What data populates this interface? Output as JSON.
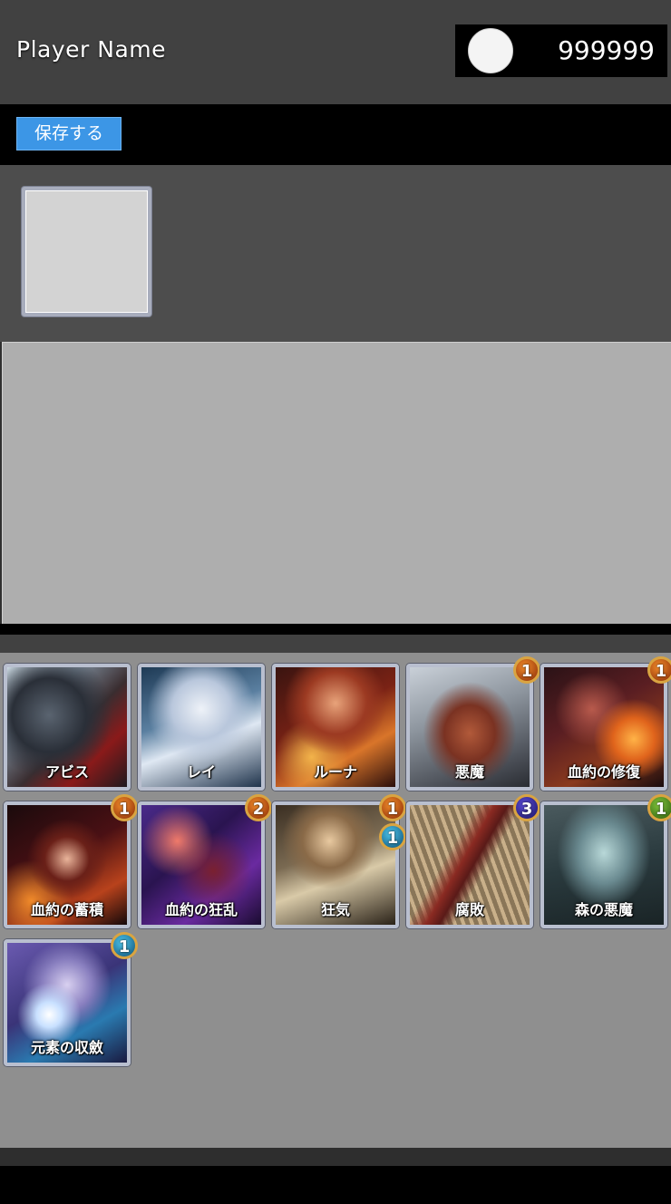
{
  "header": {
    "player_name": "Player Name",
    "currency": "999999"
  },
  "toolbar": {
    "save_label": "保存する"
  },
  "cards": [
    {
      "name": "アビス",
      "badges": []
    },
    {
      "name": "レイ",
      "badges": []
    },
    {
      "name": "ルーナ",
      "badges": []
    },
    {
      "name": "悪魔",
      "badges": [
        {
          "value": "1",
          "element": "fire"
        }
      ]
    },
    {
      "name": "血約の修復",
      "badges": [
        {
          "value": "1",
          "element": "fire"
        }
      ]
    },
    {
      "name": "血約の蓄積",
      "badges": [
        {
          "value": "1",
          "element": "fire"
        }
      ]
    },
    {
      "name": "血約の狂乱",
      "badges": [
        {
          "value": "2",
          "element": "fire"
        }
      ]
    },
    {
      "name": "狂気",
      "badges": [
        {
          "value": "1",
          "element": "fire"
        },
        {
          "value": "1",
          "element": "water"
        }
      ]
    },
    {
      "name": "腐敗",
      "badges": [
        {
          "value": "3",
          "element": "dark"
        }
      ]
    },
    {
      "name": "森の悪魔",
      "badges": [
        {
          "value": "1",
          "element": "earth"
        }
      ]
    },
    {
      "name": "元素の収斂",
      "badges": [
        {
          "value": "1",
          "element": "water"
        }
      ]
    }
  ],
  "colors": {
    "accent": "#3c96e6",
    "fire": "#c8561a",
    "water": "#2a92c0",
    "dark": "#3a2fa0",
    "earth": "#5a9a22"
  }
}
